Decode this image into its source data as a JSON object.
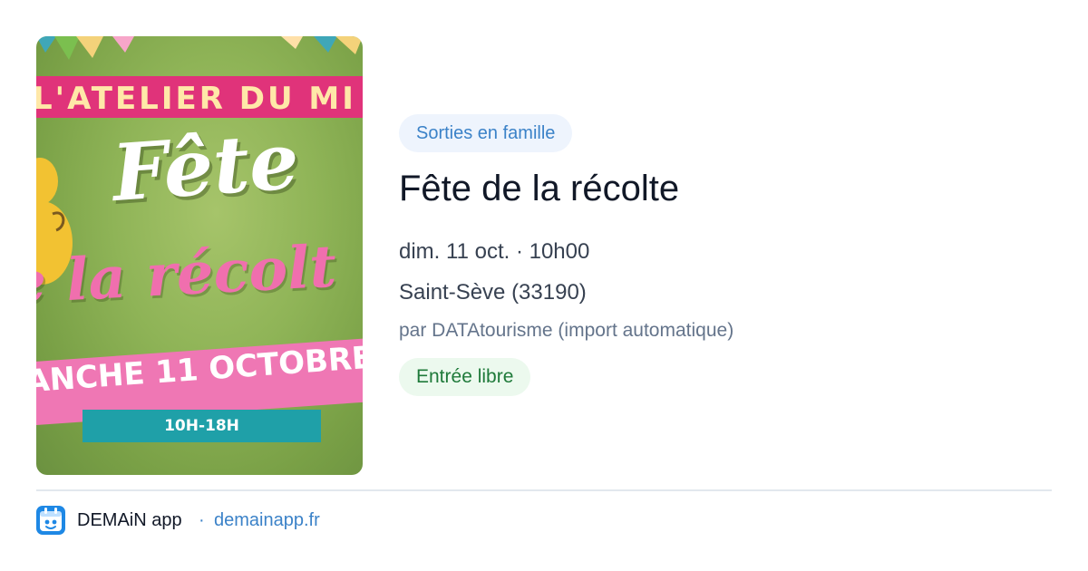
{
  "event": {
    "category": "Sorties en famille",
    "title": "Fête de la récolte",
    "datetime": "dim. 11 oct. · 10h00",
    "location": "Saint-Sève (33190)",
    "source": "par DATAtourisme (import automatique)",
    "price": "Entrée libre"
  },
  "poster": {
    "banner_text": "L'ATELIER DU MI",
    "title_line1": "Fête",
    "title_line2": "e la récolt",
    "date_text": "ANCHE 11 OCTOBRE",
    "hours_text": "10H-18H"
  },
  "footer": {
    "app_name": "DEMAiN app",
    "separator": "·",
    "link": "demainapp.fr"
  },
  "colors": {
    "category_text": "#3b82c8",
    "category_bg": "#eef4fd",
    "price_text": "#1f7a3a",
    "price_bg": "#ecf9ee",
    "poster_pink": "#e0337a",
    "poster_teal": "#1fa0a8",
    "logo_blue": "#1e88e5"
  },
  "icons": {
    "footer_logo": "demain-app-logo-icon"
  }
}
